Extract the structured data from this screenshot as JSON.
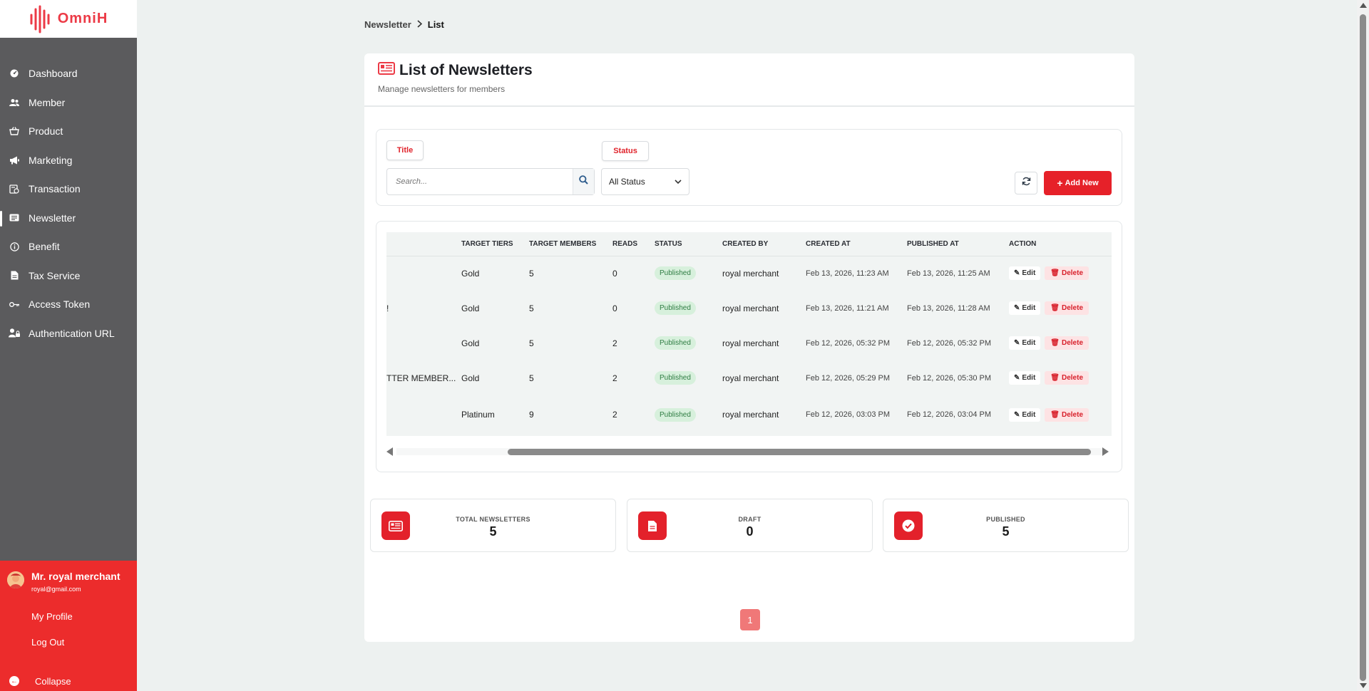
{
  "app": {
    "logo_text": "OmniH",
    "accent": "#e62129"
  },
  "sidebar": {
    "items": [
      {
        "label": "Dashboard",
        "icon": "dashboard-icon"
      },
      {
        "label": "Member",
        "icon": "users-icon"
      },
      {
        "label": "Product",
        "icon": "basket-icon"
      },
      {
        "label": "Marketing",
        "icon": "megaphone-icon"
      },
      {
        "label": "Transaction",
        "icon": "receipt-icon"
      },
      {
        "label": "Newsletter",
        "icon": "newspaper-icon",
        "active": true
      },
      {
        "label": "Benefit",
        "icon": "info-icon"
      },
      {
        "label": "Tax Service",
        "icon": "document-icon"
      },
      {
        "label": "Access Token",
        "icon": "key-icon"
      },
      {
        "label": "Authentication URL",
        "icon": "user-lock-icon"
      }
    ]
  },
  "user": {
    "name": "Mr. royal merchant",
    "email": "royal@gmail.com",
    "profile_label": "My Profile",
    "logout_label": "Log Out",
    "collapse_label": "Collapse"
  },
  "breadcrumb": {
    "parent": "Newsletter",
    "current": "List"
  },
  "page": {
    "title": "List of Newsletters",
    "subtitle": "Manage newsletters for members"
  },
  "filters": {
    "title_tag": "Title",
    "status_tag": "Status",
    "search_placeholder": "Search...",
    "status_value": "All Status",
    "add_label": "Add New"
  },
  "table": {
    "columns": [
      "TARGET TIERS",
      "TARGET MEMBERS",
      "READS",
      "STATUS",
      "CREATED BY",
      "CREATED AT",
      "PUBLISHED AT",
      "ACTION"
    ],
    "edit_label": "Edit",
    "delete_label": "Delete",
    "rows": [
      {
        "title_tail": "",
        "tier": "Gold",
        "members": "5",
        "reads": "0",
        "status": "Published",
        "created_by": "royal merchant",
        "created_at": "Feb 13, 2026, 11:23 AM",
        "published_at": "Feb 13, 2026, 11:25 AM"
      },
      {
        "title_tail": "!",
        "tier": "Gold",
        "members": "5",
        "reads": "0",
        "status": "Published",
        "created_by": "royal merchant",
        "created_at": "Feb 13, 2026, 11:21 AM",
        "published_at": "Feb 13, 2026, 11:28 AM"
      },
      {
        "title_tail": "",
        "tier": "Gold",
        "members": "5",
        "reads": "2",
        "status": "Published",
        "created_by": "royal merchant",
        "created_at": "Feb 12, 2026, 05:32 PM",
        "published_at": "Feb 12, 2026, 05:32 PM"
      },
      {
        "title_tail": "TTER MEMBER...",
        "tier": "Gold",
        "members": "5",
        "reads": "2",
        "status": "Published",
        "created_by": "royal merchant",
        "created_at": "Feb 12, 2026, 05:29 PM",
        "published_at": "Feb 12, 2026, 05:30 PM"
      },
      {
        "title_tail": "",
        "tier": "Platinum",
        "members": "9",
        "reads": "2",
        "status": "Published",
        "created_by": "royal merchant",
        "created_at": "Feb 12, 2026, 03:03 PM",
        "published_at": "Feb 12, 2026, 03:04 PM"
      }
    ]
  },
  "stats": [
    {
      "label": "TOTAL NEWSLETTERS",
      "value": "5",
      "icon": "newspaper-icon"
    },
    {
      "label": "DRAFT",
      "value": "0",
      "icon": "file-icon"
    },
    {
      "label": "PUBLISHED",
      "value": "5",
      "icon": "check-circle-icon"
    }
  ],
  "pagination": {
    "current": "1"
  }
}
